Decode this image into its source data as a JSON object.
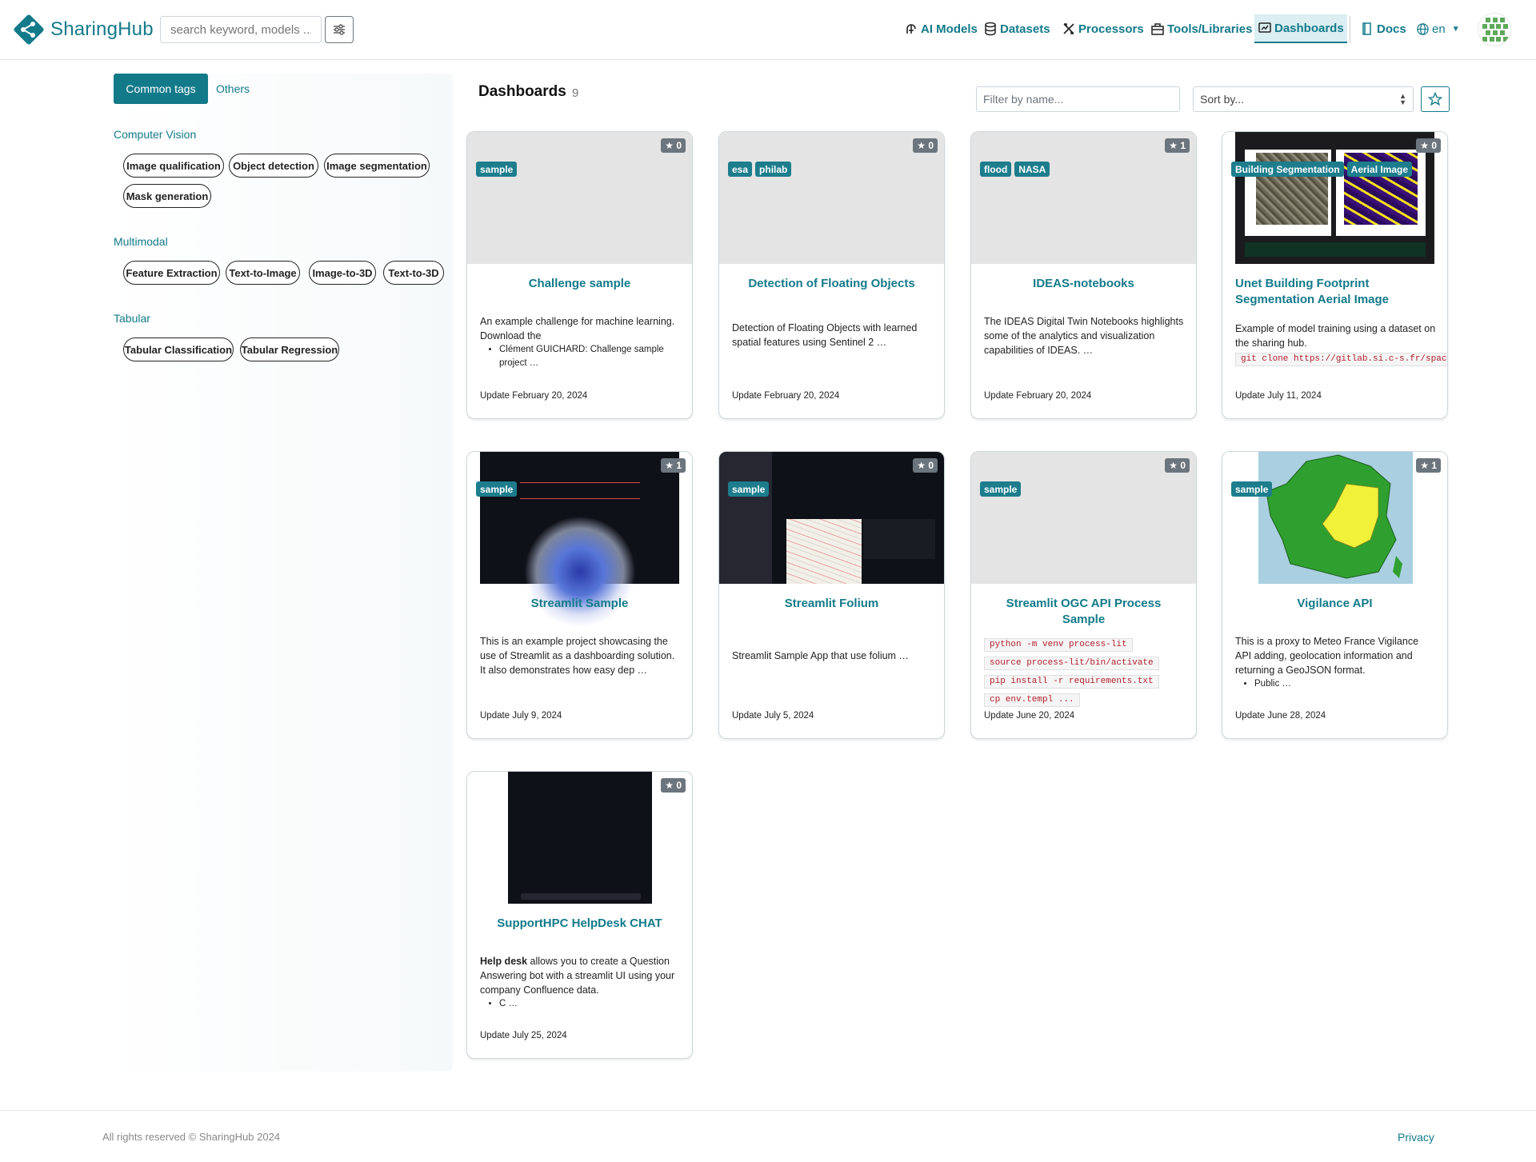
{
  "navbar": {
    "brand": "SharingHub",
    "search_placeholder": "search keyword, models ...",
    "items": [
      {
        "label": "AI Models"
      },
      {
        "label": "Datasets"
      },
      {
        "label": "Processors"
      },
      {
        "label": "Tools/Libraries"
      },
      {
        "label": "Dashboards"
      },
      {
        "label": "Docs"
      }
    ],
    "language": "en",
    "accent_color": "#137a8a"
  },
  "sidebar": {
    "tabs": [
      {
        "label": "Common tags"
      },
      {
        "label": "Others"
      }
    ],
    "sections": [
      {
        "title": "Computer Vision",
        "tags": [
          "Image qualification",
          "Object detection",
          "Image segmentation",
          "Mask generation"
        ]
      },
      {
        "title": "Multimodal",
        "tags": [
          "Feature Extraction",
          "Text-to-Image",
          "Image-to-3D",
          "Text-to-3D"
        ]
      },
      {
        "title": "Tabular",
        "tags": [
          "Tabular Classification",
          "Tabular Regression"
        ]
      }
    ]
  },
  "main": {
    "title": "Dashboards",
    "count": "9",
    "filter_placeholder": "Filter by name...",
    "sort_label": "Sort by...",
    "cards": [
      {
        "title": "Challenge sample",
        "stars": "0",
        "badges": [
          "sample"
        ],
        "desc": "An example challenge for machine learning. Download the",
        "bullet": "Clément GUICHARD: Challenge sample project …",
        "date": "Update February 20, 2024"
      },
      {
        "title": "Detection of Floating Objects",
        "stars": "0",
        "badges": [
          "esa",
          "philab"
        ],
        "desc": "Detection of Floating Objects with learned spatial features using Sentinel 2 …",
        "date": "Update February 20, 2024"
      },
      {
        "title": "IDEAS-notebooks",
        "stars": "1",
        "badges": [
          "flood",
          "NASA"
        ],
        "desc": "The IDEAS Digital Twin Notebooks highlights some of the analytics and visualization capabilities of IDEAS. …",
        "date": "Update February 20, 2024"
      },
      {
        "title": "Unet Building Footprint Segmentation Aerial Image",
        "stars": "0",
        "badges": [
          "Building Segmentation",
          "Aerial Image"
        ],
        "desc": "Example of model training using a dataset on the sharing hub.",
        "code": [
          "git clone https://gitlab.si.c-s.fr/space_"
        ],
        "date": "Update July 11, 2024"
      },
      {
        "title": "Streamlit Sample",
        "stars": "1",
        "badges": [
          "sample"
        ],
        "desc": "This is an example project showcasing the use of Streamlit as a dashboarding solution. It also demonstrates how easy dep …",
        "date": "Update July 9, 2024"
      },
      {
        "title": "Streamlit Folium",
        "stars": "0",
        "badges": [
          "sample"
        ],
        "desc": "Streamlit Sample App that use folium …",
        "date": "Update July 5, 2024"
      },
      {
        "title": "Streamlit OGC API Process Sample",
        "stars": "0",
        "badges": [
          "sample"
        ],
        "code": [
          "python -m venv process-lit",
          "source process-lit/bin/activate",
          "pip install -r requirements.txt",
          "cp env.templ ..."
        ],
        "date": "Update June 20, 2024"
      },
      {
        "title": "Vigilance API",
        "stars": "1",
        "badges": [
          "sample"
        ],
        "desc": "This is a proxy to Meteo France Vigilance API adding, geolocation information and returning a GeoJSON format.",
        "bullet": "Public …",
        "date": "Update June 28, 2024"
      },
      {
        "title": "SupportHPC HelpDesk CHAT",
        "stars": "0",
        "badges": [],
        "desc_bold": "Help desk",
        "desc": " allows you to create a Question Answering bot with a streamlit UI using your company Confluence data.",
        "bullet": "C …",
        "date": "Update July 25, 2024"
      }
    ]
  },
  "footer": {
    "copyright": "All rights reserved © SharingHub 2024",
    "privacy": "Privacy"
  }
}
